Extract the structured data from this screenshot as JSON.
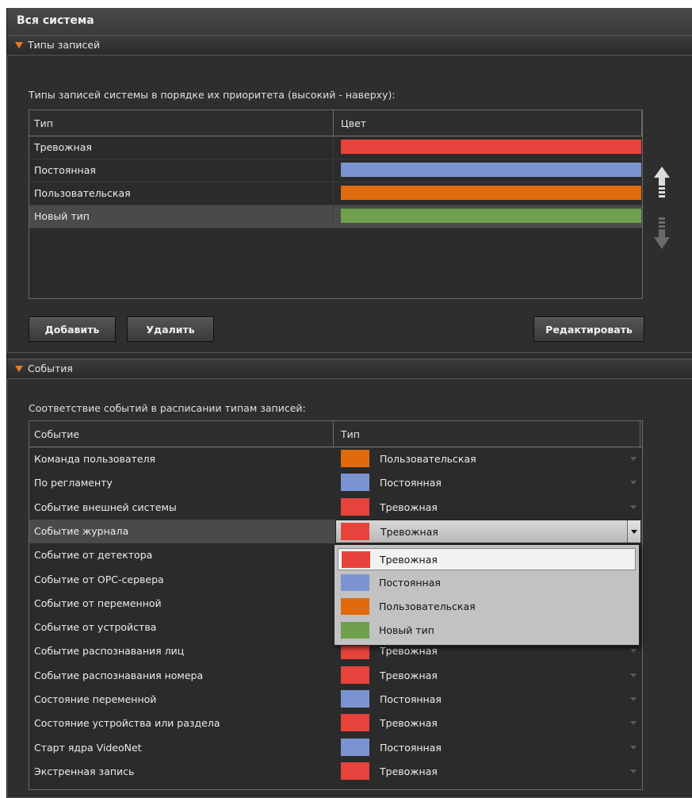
{
  "window": {
    "title": "Вся система"
  },
  "record_types": {
    "header": "Типы записей",
    "caption": "Типы записей системы в порядке их приоритета (высокий - наверху):",
    "columns": {
      "type": "Тип",
      "color": "Цвет"
    },
    "rows": [
      {
        "name": "Тревожная",
        "color": "#e8423c"
      },
      {
        "name": "Постоянная",
        "color": "#7b93d0"
      },
      {
        "name": "Пользовательская",
        "color": "#e06a0c"
      },
      {
        "name": "Новый тип",
        "color": "#6ea04e",
        "selected": true
      }
    ],
    "buttons": {
      "add": "Добавить",
      "delete": "Удалить",
      "edit": "Редактировать"
    }
  },
  "events": {
    "header": "События",
    "caption": "Соответствие событий в расписании типам записей:",
    "columns": {
      "event": "Событие",
      "type": "Тип"
    },
    "rows": [
      {
        "event": "Команда пользователя",
        "type": "Пользовательская",
        "color": "#e06a0c"
      },
      {
        "event": "По регламенту",
        "type": "Постоянная",
        "color": "#7b93d0"
      },
      {
        "event": "Событие внешней системы",
        "type": "Тревожная",
        "color": "#e8423c"
      },
      {
        "event": "Событие журнала",
        "type": "Тревожная",
        "color": "#e8423c",
        "selected": true
      },
      {
        "event": "Событие от детектора",
        "type": "",
        "color": ""
      },
      {
        "event": "Событие от OPC-сервера",
        "type": "",
        "color": ""
      },
      {
        "event": "Событие от переменной",
        "type": "",
        "color": ""
      },
      {
        "event": "Событие от устройства",
        "type": "",
        "color": ""
      },
      {
        "event": "Событие распознавания лиц",
        "type": "Тревожная",
        "color": "#e8423c"
      },
      {
        "event": "Событие распознавания номера",
        "type": "Тревожная",
        "color": "#e8423c"
      },
      {
        "event": "Состояние переменной",
        "type": "Постоянная",
        "color": "#7b93d0"
      },
      {
        "event": "Состояние устройства или раздела",
        "type": "Тревожная",
        "color": "#e8423c"
      },
      {
        "event": "Старт ядра VideoNet",
        "type": "Постоянная",
        "color": "#7b93d0"
      },
      {
        "event": "Экстренная запись",
        "type": "Тревожная",
        "color": "#e8423c"
      }
    ],
    "dropdown_options": [
      {
        "label": "Тревожная",
        "color": "#e8423c",
        "highlighted": true
      },
      {
        "label": "Постоянная",
        "color": "#7b93d0"
      },
      {
        "label": "Пользовательская",
        "color": "#e06a0c"
      },
      {
        "label": "Новый тип",
        "color": "#6ea04e"
      }
    ]
  },
  "icons": {
    "move_up": "arrow-up-icon",
    "move_down": "arrow-down-icon",
    "expand": "triangle-down-icon"
  }
}
